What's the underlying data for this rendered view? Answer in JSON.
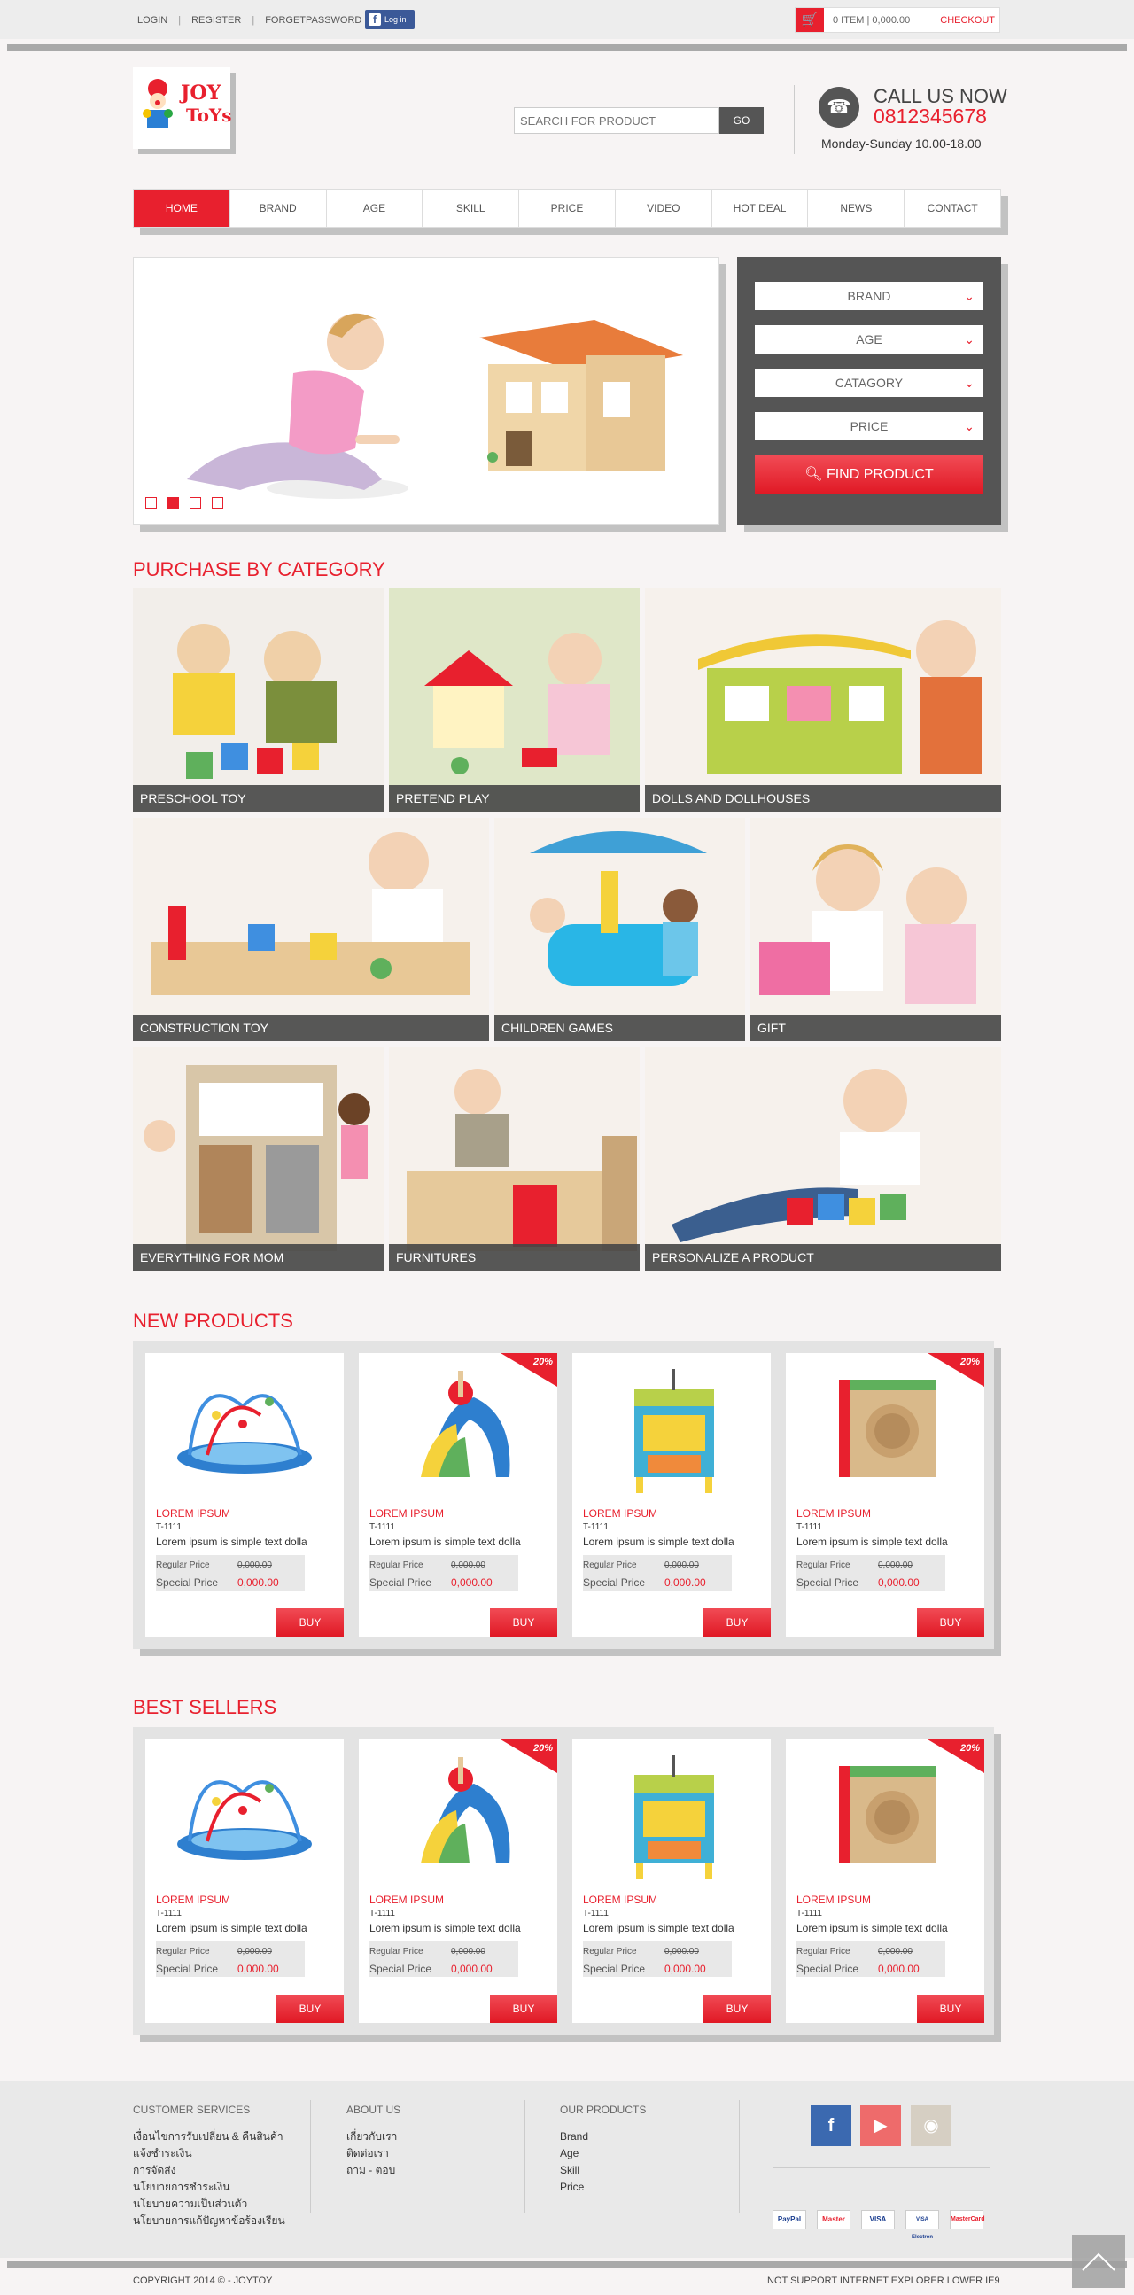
{
  "topbar": {
    "login": "LOGIN",
    "register": "REGISTER",
    "forget": "FORGETPASSWORD",
    "fb_login": "Log in",
    "cart_text": "0 ITEM | 0,000.00",
    "checkout": "CHECKOUT"
  },
  "header": {
    "logo_line1": "JOY",
    "logo_line2": "ToYs",
    "search_placeholder": "SEARCH FOR PRODUCT",
    "go": "GO",
    "call_us": "CALL US NOW",
    "phone": "0812345678",
    "hours": "Monday-Sunday 10.00-18.00"
  },
  "nav": [
    "HOME",
    "BRAND",
    "AGE",
    "SKILL",
    "PRICE",
    "VIDEO",
    "HOT DEAL",
    "NEWS",
    "CONTACT"
  ],
  "finder": {
    "brand": "BRAND",
    "age": "AGE",
    "category": "CATAGORY",
    "price": "PRICE",
    "find": "FIND PRODUCT"
  },
  "sections": {
    "categories": "PURCHASE BY CATEGORY",
    "new_products": "NEW PRODUCTS",
    "best_sellers": "BEST SELLERS"
  },
  "categories": [
    "PRESCHOOL TOY",
    "PRETEND PLAY",
    "DOLLS AND DOLLHOUSES",
    "CONSTRUCTION TOY",
    "CHILDREN GAMES",
    "GIFT",
    "EVERYTHING FOR MOM",
    "FURNITURES",
    "PERSONALIZE A PRODUCT"
  ],
  "product": {
    "name": "LOREM IPSUM",
    "code": "T-1111",
    "desc": "Lorem ipsum is simple text dolla",
    "regular_label": "Regular Price",
    "regular_value": "0,000.00",
    "special_label": "Special Price",
    "special_value": "0,000.00",
    "buy": "BUY",
    "discount": "20%"
  },
  "footer": {
    "customer_services": "CUSTOMER SERVICES",
    "cs_links": [
      "เงื่อนไขการรับเปลี่ยน & คืนสินค้า",
      "แจ้งชำระเงิน",
      "การจัดส่ง",
      "นโยบายการชำระเงิน",
      "นโยบายความเป็นส่วนตัว",
      "นโยบายการแก้ปัญหาข้อร้องเรียน"
    ],
    "about_us": "ABOUT US",
    "about_links": [
      "เกี่ยวกับเรา",
      "ติดต่อเรา",
      "ถาม - ตอบ"
    ],
    "our_products": "OUR PRODUCTS",
    "product_links": [
      "Brand",
      "Age",
      "Skill",
      "Price"
    ],
    "payments": [
      "PayPal",
      "Master",
      "VISA",
      "VISA Electron",
      "MasterCard"
    ],
    "copyright": "COPYRIGHT 2014 © - JOYTOY",
    "not_support": "NOT SUPPORT INTERNET EXPLORER LOWER IE9"
  }
}
